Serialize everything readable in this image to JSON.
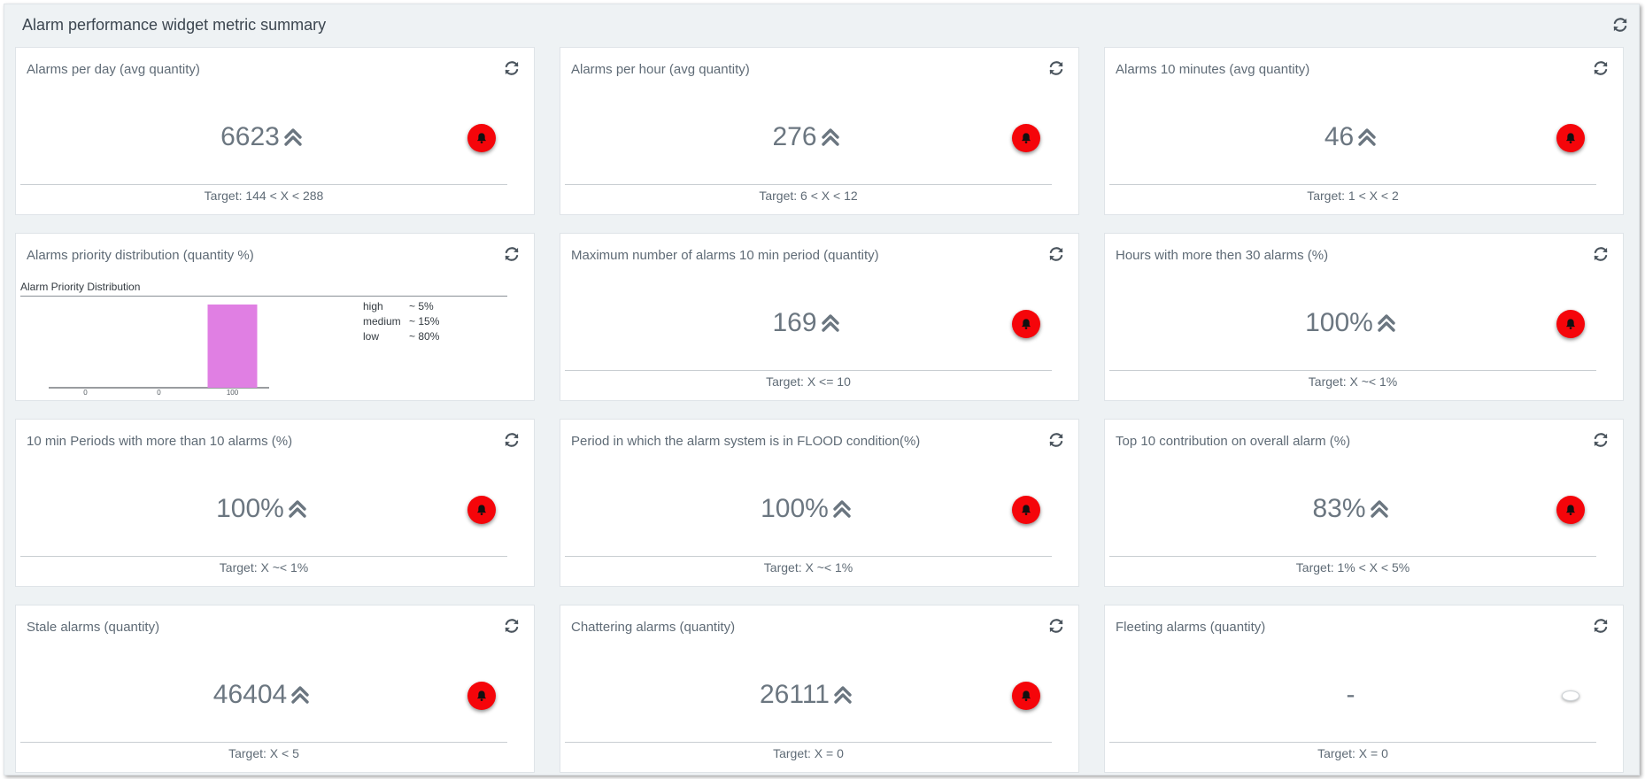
{
  "panel": {
    "title": "Alarm performance widget metric summary",
    "refresh_icon": "refresh-icon"
  },
  "colors": {
    "alarm_red": "#f5050a",
    "bar": "#e07fe3",
    "panel_bg": "#eef2f4"
  },
  "widgets": [
    {
      "title": "Alarms per day (avg quantity)",
      "value": "6623",
      "trend": "double-chevron-up-icon",
      "status": "alarm",
      "target": "Target: 144 < X < 288"
    },
    {
      "title": "Alarms per hour (avg quantity)",
      "value": "276",
      "trend": "double-chevron-up-icon",
      "status": "alarm",
      "target": "Target: 6 < X < 12"
    },
    {
      "title": "Alarms 10 minutes (avg quantity)",
      "value": "46",
      "trend": "double-chevron-up-icon",
      "status": "alarm",
      "target": "Target: 1 < X < 2"
    },
    {
      "title": "Alarms priority distribution (quantity %)",
      "type": "chart"
    },
    {
      "title": "Maximum number of alarms 10 min period (quantity)",
      "value": "169",
      "trend": "double-chevron-up-icon",
      "status": "alarm",
      "target": "Target: X <= 10"
    },
    {
      "title": "Hours with more then 30 alarms (%)",
      "value": "100%",
      "trend": "double-chevron-up-icon",
      "status": "alarm",
      "target": "Target: X ~< 1%"
    },
    {
      "title": "10 min Periods with more than 10 alarms (%)",
      "value": "100%",
      "trend": "double-chevron-up-icon",
      "status": "alarm",
      "target": "Target: X ~< 1%"
    },
    {
      "title": "Period in which the alarm system is in FLOOD condition(%)",
      "value": "100%",
      "trend": "double-chevron-up-icon",
      "status": "alarm",
      "target": "Target: X ~< 1%"
    },
    {
      "title": "Top 10 contribution on overall alarm (%)",
      "value": "83%",
      "trend": "double-chevron-up-icon",
      "status": "alarm",
      "target": "Target: 1% < X < 5%"
    },
    {
      "title": "Stale alarms (quantity)",
      "value": "46404",
      "trend": "double-chevron-up-icon",
      "status": "alarm",
      "target": "Target: X < 5"
    },
    {
      "title": "Chattering alarms (quantity)",
      "value": "26111",
      "trend": "double-chevron-up-icon",
      "status": "alarm",
      "target": "Target: X = 0"
    },
    {
      "title": "Fleeting alarms (quantity)",
      "value": "-",
      "trend": "",
      "status": "off",
      "target": "Target: X = 0"
    }
  ],
  "chart_data": {
    "type": "bar",
    "title": "Alarm Priority Distribution",
    "categories": [
      "0",
      "0",
      "100"
    ],
    "values": [
      0,
      0,
      100
    ],
    "ylim": [
      0,
      100
    ],
    "grid": false,
    "legend_position": "right",
    "legend": [
      {
        "name": "high",
        "value": "~  5%"
      },
      {
        "name": "medium",
        "value": "~ 15%"
      },
      {
        "name": "low",
        "value": "~ 80%"
      }
    ]
  }
}
